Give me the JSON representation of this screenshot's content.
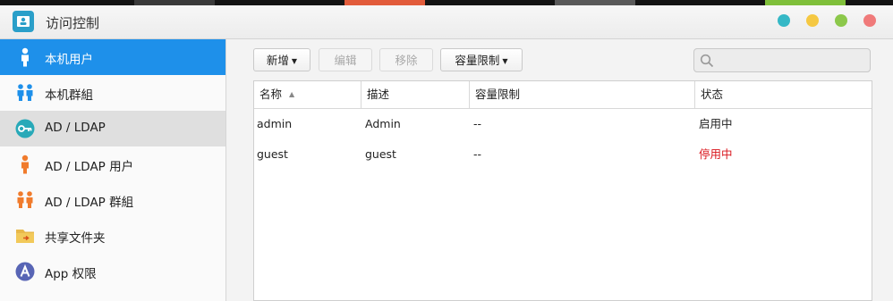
{
  "window": {
    "title": "访问控制"
  },
  "colors": {
    "accent": "#1e90ea",
    "close": "#f07a7a",
    "maximize": "#8cc84b",
    "minimize": "#f5c842",
    "help": "#35b8c6",
    "status_disabled": "#d9141b"
  },
  "sidebar": {
    "items": [
      {
        "label": "本机用户",
        "icon": "user-icon",
        "state": "active"
      },
      {
        "label": "本机群組",
        "icon": "group-icon",
        "state": ""
      },
      {
        "label": "AD / LDAP",
        "icon": "key-icon",
        "state": "highlight"
      },
      {
        "label": "AD / LDAP 用户",
        "icon": "ldap-user-icon",
        "state": ""
      },
      {
        "label": "AD / LDAP 群組",
        "icon": "ldap-group-icon",
        "state": ""
      },
      {
        "label": "共享文件夹",
        "icon": "folder-icon",
        "state": ""
      },
      {
        "label": "App 权限",
        "icon": "app-icon",
        "state": ""
      }
    ]
  },
  "toolbar": {
    "add_label": "新增",
    "edit_label": "编辑",
    "remove_label": "移除",
    "quota_label": "容量限制",
    "search_placeholder": ""
  },
  "table": {
    "columns": [
      "名称",
      "描述",
      "容量限制",
      "状态"
    ],
    "rows": [
      {
        "name": "admin",
        "description": "Admin",
        "quota": "--",
        "status": "启用中"
      },
      {
        "name": "guest",
        "description": "guest",
        "quota": "--",
        "status": "停用中"
      }
    ]
  }
}
